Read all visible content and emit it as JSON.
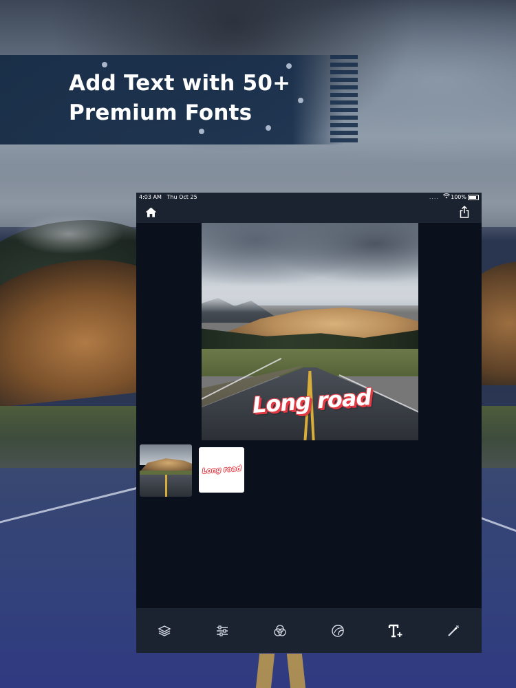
{
  "promo": {
    "headline_line1": "Add Text with 50+",
    "headline_line2": "Premium Fonts",
    "accent_color": "#172c46"
  },
  "statusbar": {
    "time": "4:03 AM",
    "date": "Thu Oct 25",
    "battery": "100%",
    "dots": "....",
    "wifi_icon": "wifi-icon",
    "battery_icon": "battery-icon"
  },
  "navbar": {
    "home_icon": "home-icon",
    "share_icon": "share-icon"
  },
  "canvas": {
    "overlay_text": "Long road",
    "overlay_text_color": "#ffffff",
    "overlay_stroke_color": "#e23b45"
  },
  "layers": [
    {
      "type": "photo",
      "label": ""
    },
    {
      "type": "text",
      "label": "Long road"
    }
  ],
  "toolbar": {
    "tools": [
      {
        "icon": "layers-icon"
      },
      {
        "icon": "adjust-sliders-icon"
      },
      {
        "icon": "filters-icon"
      },
      {
        "icon": "sticker-icon"
      },
      {
        "icon": "add-text-icon"
      },
      {
        "icon": "magic-wand-icon"
      }
    ]
  }
}
